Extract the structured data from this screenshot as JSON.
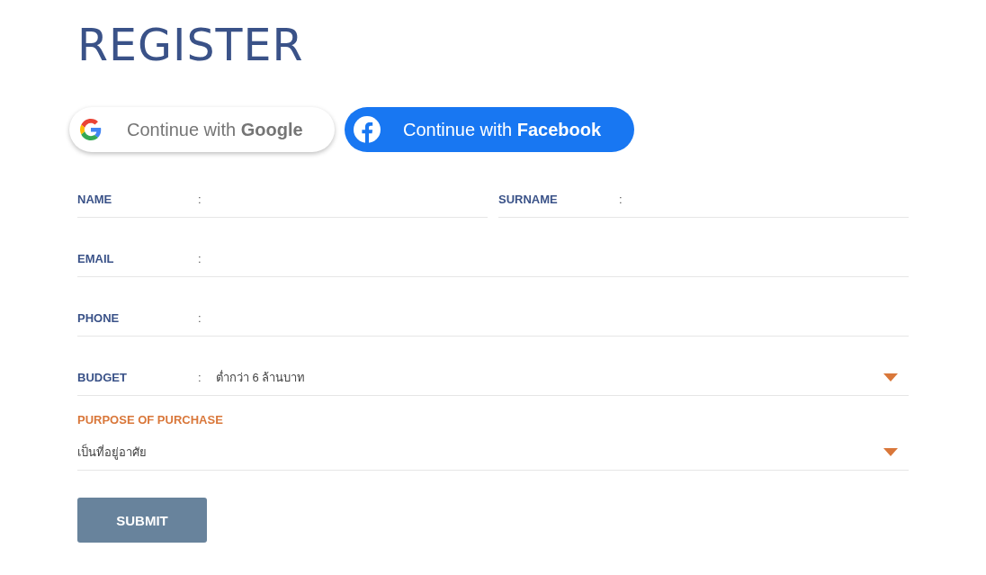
{
  "title": "REGISTER",
  "social_buttons": [
    {
      "kind": "google",
      "text": "Continue with ",
      "brand": "Google"
    },
    {
      "kind": "facebook",
      "text": "Continue with ",
      "brand": "Facebook"
    }
  ],
  "rows": [
    [
      {
        "label": "NAME",
        "separator": ":",
        "kind": "text"
      },
      {
        "label": "SURNAME",
        "separator": ":",
        "kind": "text"
      }
    ],
    [
      {
        "label": "EMAIL",
        "separator": ":",
        "kind": "text"
      }
    ],
    [
      {
        "label": "PHONE",
        "separator": ":",
        "kind": "text"
      }
    ],
    [
      {
        "label": "BUDGET",
        "separator": ":",
        "kind": "select",
        "value": "ต่ำกว่า 6 ล้านบาท"
      }
    ]
  ],
  "purpose": {
    "label": "PURPOSE OF PURCHASE",
    "value": "เป็นที่อยู่อาศัย"
  },
  "submit": "SUBMIT"
}
